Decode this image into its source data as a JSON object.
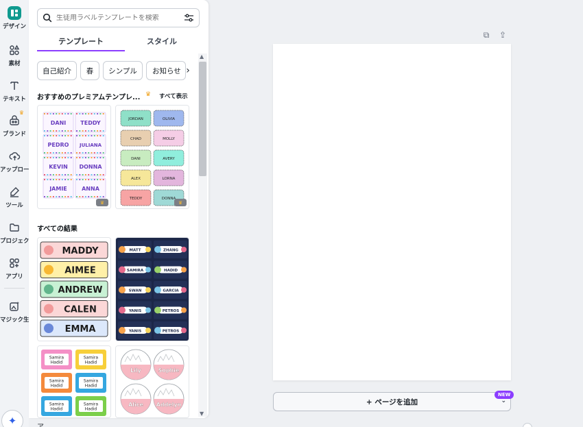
{
  "rail": {
    "items": [
      {
        "label": "デザイン",
        "icon": "design-logo-icon"
      },
      {
        "label": "素材",
        "icon": "elements-icon"
      },
      {
        "label": "テキスト",
        "icon": "text-icon"
      },
      {
        "label": "ブランド",
        "icon": "brand-icon"
      },
      {
        "label": "アップロード",
        "icon": "upload-cloud-icon"
      },
      {
        "label": "ツール",
        "icon": "draw-tool-icon"
      },
      {
        "label": "プロジェクト",
        "icon": "folder-icon"
      },
      {
        "label": "アプリ",
        "icon": "apps-icon"
      },
      {
        "label": "マジック生成",
        "icon": "magic-media-icon"
      }
    ]
  },
  "search": {
    "placeholder": "生徒用ラベルテンプレートを検索"
  },
  "tabs": [
    {
      "label": "テンプレート"
    },
    {
      "label": "スタイル"
    }
  ],
  "chips": [
    {
      "label": "自己紹介"
    },
    {
      "label": "春"
    },
    {
      "label": "シンプル"
    },
    {
      "label": "お知らせ"
    }
  ],
  "premium": {
    "title": "おすすめのプレミアムテンプレ...",
    "see_all": "すべて表示",
    "card1_names": [
      "DANI",
      "TEDDY",
      "PEDRO",
      "JULIANA",
      "KEVIN",
      "DONNA",
      "JAMIE",
      "ANNA"
    ],
    "card2_names": [
      "JORDAN",
      "OLIVIA",
      "CHAD",
      "MOLLY",
      "DANI",
      "AVERY",
      "ALEX",
      "LORNA",
      "TEDDY",
      "DONNA"
    ]
  },
  "results": {
    "title": "すべての結果",
    "card3_names": [
      "MADDY",
      "AIMEE",
      "ANDREW",
      "CALEN",
      "EMMA"
    ],
    "card4_names": [
      "MATT",
      "ZHANG",
      "SAMIRA",
      "HADID",
      "SWAN",
      "GARCIA",
      "YANIS",
      "PETROS",
      "YANIS",
      "PETROS"
    ],
    "card5_names": [
      "Samira Hadid",
      "Samira Hadid",
      "Samira Hadid",
      "Samira Hadid",
      "Samira Hadid",
      "Samira Hadid"
    ],
    "card6_names": [
      "Lily",
      "Sophie",
      "Alice",
      "Addelyn"
    ]
  },
  "canvas": {
    "add_page_label": "+ ページを追加",
    "new_badge": "NEW",
    "bottom_text": "ア..."
  },
  "colors": {
    "accent": "#8b3dff",
    "brand_teal": "#0f9a8f",
    "premium_crown": "#f0a11c"
  }
}
